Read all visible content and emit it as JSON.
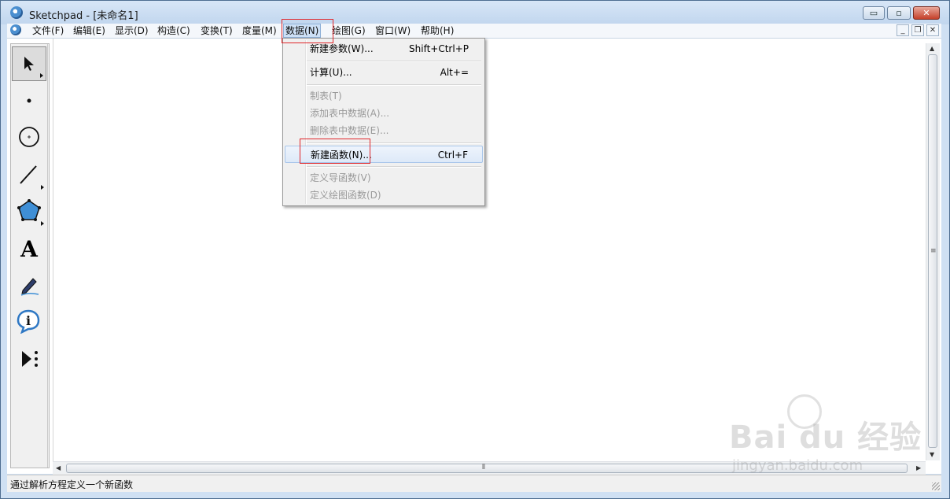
{
  "window": {
    "title": "Sketchpad  - [未命名1]",
    "controls": {
      "minimize": "▭",
      "maximize": "▫",
      "close": "✕"
    }
  },
  "menubar": {
    "items": [
      {
        "label": "文件(F)"
      },
      {
        "label": "编辑(E)"
      },
      {
        "label": "显示(D)"
      },
      {
        "label": "构造(C)"
      },
      {
        "label": "变换(T)"
      },
      {
        "label": "度量(M)"
      },
      {
        "label": "数据(N)",
        "active": true
      },
      {
        "label": "绘图(G)"
      },
      {
        "label": "窗口(W)"
      },
      {
        "label": "帮助(H)"
      }
    ],
    "mdi_controls": {
      "minimize": "_",
      "restore": "❐",
      "close": "✕"
    }
  },
  "dropdown": {
    "items": [
      {
        "label": "新建参数(W)...",
        "shortcut": "Shift+Ctrl+P",
        "enabled": true
      },
      {
        "label": "计算(U)...",
        "shortcut": "Alt+=",
        "enabled": true
      },
      {
        "label": "制表(T)",
        "shortcut": "",
        "enabled": false
      },
      {
        "label": "添加表中数据(A)...",
        "shortcut": "",
        "enabled": false
      },
      {
        "label": "删除表中数据(E)...",
        "shortcut": "",
        "enabled": false
      },
      {
        "label": "新建函数(N)...",
        "shortcut": "Ctrl+F",
        "enabled": true,
        "highlighted": true
      },
      {
        "label": "定义导函数(V)",
        "shortcut": "",
        "enabled": false
      },
      {
        "label": "定义绘图函数(D)",
        "shortcut": "",
        "enabled": false
      }
    ]
  },
  "toolbox": {
    "tools": [
      {
        "name": "arrow-select-tool-icon",
        "selected": true
      },
      {
        "name": "point-tool-icon"
      },
      {
        "name": "compass-tool-icon"
      },
      {
        "name": "straightedge-tool-icon"
      },
      {
        "name": "polygon-tool-icon"
      },
      {
        "name": "text-tool-icon",
        "glyph": "A"
      },
      {
        "name": "marker-tool-icon"
      },
      {
        "name": "information-tool-icon"
      },
      {
        "name": "custom-tool-icon"
      }
    ]
  },
  "statusbar": {
    "text": "通过解析方程定义一个新函数"
  },
  "watermark": {
    "line1": "Bai du 经验",
    "line2": "jingyan.baidu.com"
  },
  "colors": {
    "annotation_box": "#e0262a",
    "menu_highlight": "#cde0f6"
  }
}
